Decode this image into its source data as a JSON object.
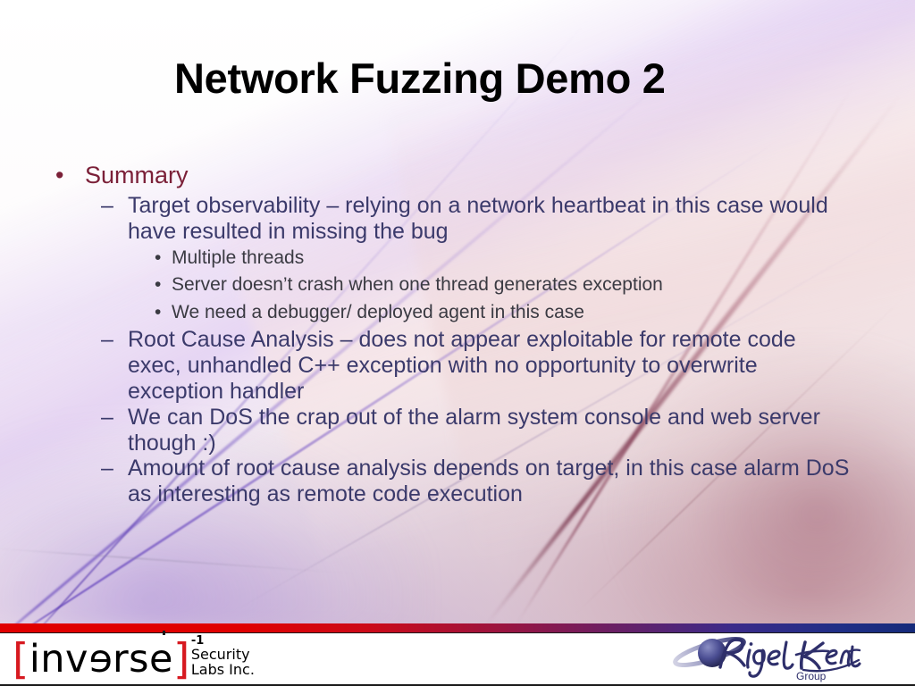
{
  "slide": {
    "title": "Network Fuzzing Demo 2",
    "content": {
      "level1": {
        "bullet_glyph": "•",
        "text": "Summary"
      },
      "items": [
        {
          "level": 2,
          "bullet_glyph": "–",
          "text": "Target observability – relying on a network heartbeat in this case would have resulted in missing the bug"
        },
        {
          "level": 3,
          "bullet_glyph": "•",
          "text": "Multiple threads"
        },
        {
          "level": 3,
          "bullet_glyph": "•",
          "text": "Server doesn’t crash when one thread generates exception"
        },
        {
          "level": 3,
          "bullet_glyph": "•",
          "text": "We need a debugger/ deployed agent in this case"
        },
        {
          "level": 2,
          "bullet_glyph": "–",
          "text": "Root Cause Analysis – does not appear exploitable for remote code exec, unhandled C++ exception with no opportunity to overwrite exception handler"
        },
        {
          "level": 2,
          "bullet_glyph": "–",
          "text": "We can DoS the crap out of the alarm system console and web server though :)"
        },
        {
          "level": 2,
          "bullet_glyph": "–",
          "text": "Amount of root cause analysis depends on target, in this case alarm DoS as interesting as remote code execution"
        }
      ]
    }
  },
  "footer": {
    "left_logo": {
      "bracket_open": "[",
      "word_part_1": "inv",
      "word_reversed_letter": "e",
      "word_part_2": "rse",
      "bracket_close": "]",
      "superscript": "-1",
      "line1": "Security",
      "line2": "Labs Inc."
    },
    "right_logo": {
      "wordmark": "Rigel Kent",
      "subtext": "Group"
    }
  },
  "colors": {
    "title": "#000000",
    "level1_text": "#7B2038",
    "level2_text": "#3B3A6B",
    "level3_text": "#3A3A42",
    "logo_bracket_red": "#D71920",
    "rigel_navy": "#2E2F6B",
    "footer_bar_left": "#E00000",
    "footer_bar_right": "#152A7A",
    "background": "#FFFFFF"
  }
}
